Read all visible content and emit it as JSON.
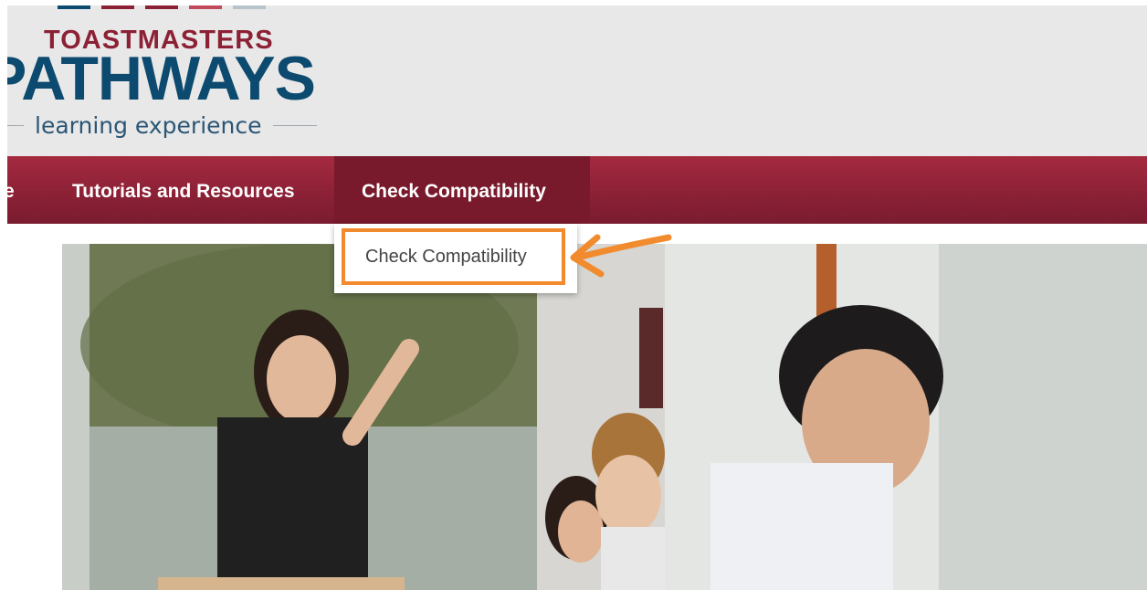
{
  "header": {
    "logo": {
      "brand_top": "TOASTMASTERS",
      "brand_main": "PATHWAYS",
      "tagline": "learning experience",
      "bar_colors": [
        "#0d4a6f",
        "#8c2136",
        "#8c2136",
        "#c04a5a",
        "#b8c4cc"
      ]
    }
  },
  "nav": {
    "items": [
      {
        "label": "e"
      },
      {
        "label": "Tutorials and Resources"
      },
      {
        "label": "Check Compatibility"
      }
    ],
    "background_color": "#8c2136",
    "active_background_color": "#781a2c"
  },
  "dropdown": {
    "items": [
      {
        "label": "Check Compatibility"
      }
    ],
    "highlight_color": "#f28a2e"
  },
  "hero": {
    "description": "Photo of a presenter gesturing at a screen with seated attendees"
  }
}
